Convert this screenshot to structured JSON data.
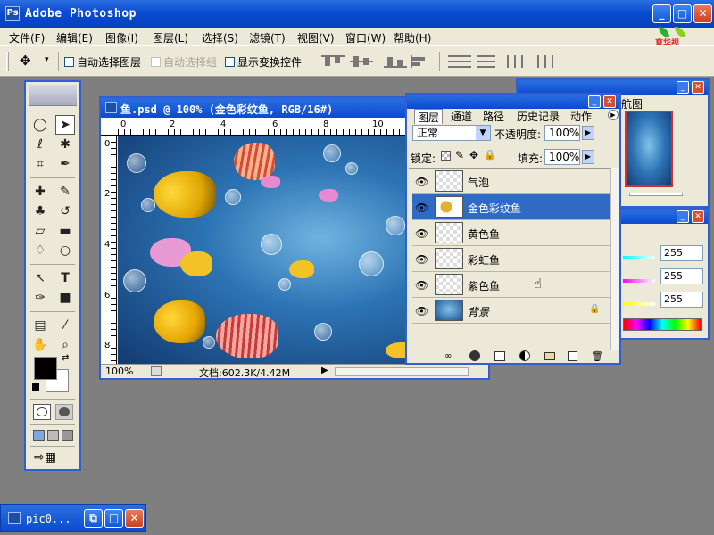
{
  "app": {
    "title": "Adobe Photoshop",
    "icon_label": "Ps"
  },
  "window_buttons": {
    "minimize": "_",
    "maximize": "□",
    "close": "✕"
  },
  "menu": [
    "文件(F)",
    "编辑(E)",
    "图像(I)",
    "图层(L)",
    "选择(S)",
    "滤镜(T)",
    "视图(V)",
    "窗口(W)",
    "帮助(H)"
  ],
  "logo": {
    "text": "育华视"
  },
  "options": {
    "move_tool_arrow": "▾",
    "auto_select_layer": "自动选择图层",
    "auto_select_group": "自动选择组",
    "show_transform_controls": "显示变换控件"
  },
  "toolbox": {
    "tools": [
      [
        "marquee-tool",
        "◯"
      ],
      [
        "move-tool",
        "➤"
      ],
      [
        "lasso-tool",
        "ℓ"
      ],
      [
        "magic-wand-tool",
        "✱"
      ],
      [
        "crop-tool",
        "⌗"
      ],
      [
        "slice-tool",
        "✒"
      ],
      [
        "healing-brush-tool",
        "✚"
      ],
      [
        "brush-tool",
        "✎"
      ],
      [
        "clone-stamp-tool",
        "♣"
      ],
      [
        "history-brush-tool",
        "↺"
      ],
      [
        "eraser-tool",
        "▱"
      ],
      [
        "gradient-tool",
        "▬"
      ],
      [
        "blur-tool",
        "♢"
      ],
      [
        "dodge-tool",
        "○"
      ],
      [
        "path-selection-tool",
        "↖"
      ],
      [
        "type-tool",
        "T"
      ],
      [
        "pen-tool",
        "✑"
      ],
      [
        "shape-tool",
        "■"
      ],
      [
        "notes-tool",
        "▤"
      ],
      [
        "eyedropper-tool",
        "⁄"
      ],
      [
        "hand-tool",
        "✋"
      ],
      [
        "zoom-tool",
        "⌕"
      ]
    ],
    "foreground_color": "#000000",
    "background_color": "#ffffff"
  },
  "document": {
    "title": "鱼.psd @ 100% (金色彩纹鱼, RGB/16#)",
    "ruler_h": [
      "0",
      "2",
      "4",
      "6",
      "8",
      "10"
    ],
    "ruler_v": [
      "0",
      "2",
      "4",
      "6",
      "8"
    ],
    "zoom": "100%",
    "doc_size": "文档:602.3K/4.42M"
  },
  "layers_panel": {
    "tabs": [
      "图层",
      "通道",
      "路径",
      "历史记录",
      "动作"
    ],
    "blend_mode": "正常",
    "opacity_label": "不透明度:",
    "opacity": "100%",
    "lock_label": "锁定:",
    "fill_label": "填充:",
    "fill": "100%",
    "layers": [
      {
        "name": "气泡",
        "active": false
      },
      {
        "name": "金色彩纹鱼",
        "active": true
      },
      {
        "name": "黄色鱼",
        "active": false
      },
      {
        "name": "彩虹鱼",
        "active": false
      },
      {
        "name": "紫色鱼",
        "active": false
      },
      {
        "name": "背景",
        "active": false,
        "locked": true
      }
    ],
    "lock_icon": "🔒",
    "footer_icons": [
      "link-icon",
      "fx-icon",
      "mask-icon",
      "adjustment-icon",
      "folder-icon",
      "new-layer-icon",
      "trash-icon"
    ]
  },
  "navigator_panel": {
    "tab": "航图"
  },
  "color_panel": {
    "values": [
      "255",
      "255",
      "255"
    ]
  },
  "taskbar": {
    "label": "pic0..."
  },
  "colors": {
    "xp_blue": "#0a4bd0",
    "panel_bg": "#ece9d8",
    "selection": "#316ac5",
    "workspace": "#7f7f7f"
  }
}
